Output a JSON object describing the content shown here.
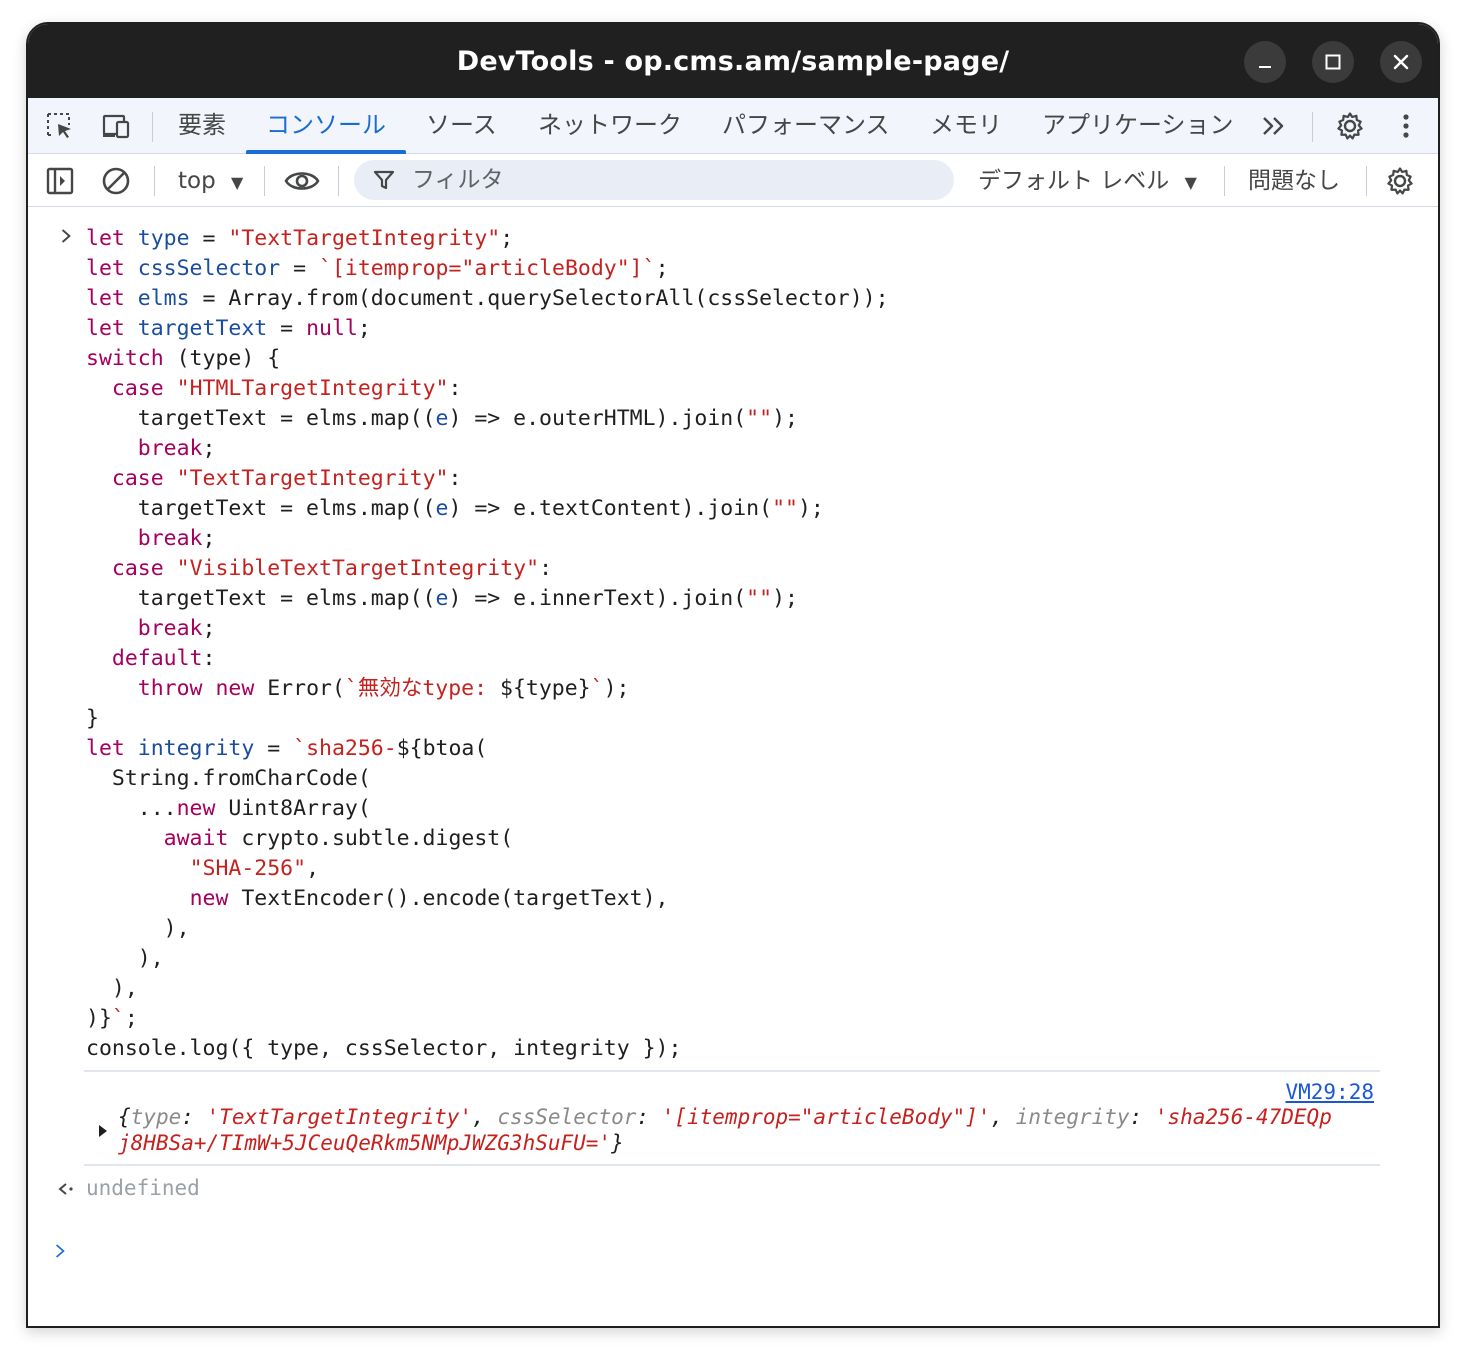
{
  "window": {
    "title": "DevTools - op.cms.am/sample-page/"
  },
  "tabs": [
    {
      "label": "要素"
    },
    {
      "label": "コンソール",
      "active": true
    },
    {
      "label": "ソース"
    },
    {
      "label": "ネットワーク"
    },
    {
      "label": "パフォーマンス"
    },
    {
      "label": "メモリ"
    },
    {
      "label": "アプリケーション"
    }
  ],
  "toolbar": {
    "context": "top",
    "filter_placeholder": "フィルタ",
    "level": "デフォルト レベル",
    "issues": "問題なし"
  },
  "console": {
    "code": [
      [
        {
          "t": "let ",
          "c": "k"
        },
        {
          "t": "type",
          "c": "v"
        },
        {
          "t": " = ",
          "c": "n"
        },
        {
          "t": "\"TextTargetIntegrity\"",
          "c": "s"
        },
        {
          "t": ";",
          "c": "n"
        }
      ],
      [
        {
          "t": "let ",
          "c": "k"
        },
        {
          "t": "cssSelector",
          "c": "v"
        },
        {
          "t": " = ",
          "c": "n"
        },
        {
          "t": "`[itemprop=\"articleBody\"]`",
          "c": "s"
        },
        {
          "t": ";",
          "c": "n"
        }
      ],
      [
        {
          "t": "let ",
          "c": "k"
        },
        {
          "t": "elms",
          "c": "v"
        },
        {
          "t": " = Array.from(document.querySelectorAll(cssSelector));",
          "c": "n"
        }
      ],
      [
        {
          "t": "let ",
          "c": "k"
        },
        {
          "t": "targetText",
          "c": "v"
        },
        {
          "t": " = ",
          "c": "n"
        },
        {
          "t": "null",
          "c": "k"
        },
        {
          "t": ";",
          "c": "n"
        }
      ],
      [
        {
          "t": "switch",
          "c": "k"
        },
        {
          "t": " (type) {",
          "c": "n"
        }
      ],
      [
        {
          "t": "  ",
          "c": "n"
        },
        {
          "t": "case ",
          "c": "k"
        },
        {
          "t": "\"HTMLTargetIntegrity\"",
          "c": "s"
        },
        {
          "t": ":",
          "c": "n"
        }
      ],
      [
        {
          "t": "    targetText = elms.map((",
          "c": "n"
        },
        {
          "t": "e",
          "c": "v"
        },
        {
          "t": ") => e.outerHTML).join(",
          "c": "n"
        },
        {
          "t": "\"\"",
          "c": "s"
        },
        {
          "t": ");",
          "c": "n"
        }
      ],
      [
        {
          "t": "    ",
          "c": "n"
        },
        {
          "t": "break",
          "c": "k"
        },
        {
          "t": ";",
          "c": "n"
        }
      ],
      [
        {
          "t": "  ",
          "c": "n"
        },
        {
          "t": "case ",
          "c": "k"
        },
        {
          "t": "\"TextTargetIntegrity\"",
          "c": "s"
        },
        {
          "t": ":",
          "c": "n"
        }
      ],
      [
        {
          "t": "    targetText = elms.map((",
          "c": "n"
        },
        {
          "t": "e",
          "c": "v"
        },
        {
          "t": ") => e.textContent).join(",
          "c": "n"
        },
        {
          "t": "\"\"",
          "c": "s"
        },
        {
          "t": ");",
          "c": "n"
        }
      ],
      [
        {
          "t": "    ",
          "c": "n"
        },
        {
          "t": "break",
          "c": "k"
        },
        {
          "t": ";",
          "c": "n"
        }
      ],
      [
        {
          "t": "  ",
          "c": "n"
        },
        {
          "t": "case ",
          "c": "k"
        },
        {
          "t": "\"VisibleTextTargetIntegrity\"",
          "c": "s"
        },
        {
          "t": ":",
          "c": "n"
        }
      ],
      [
        {
          "t": "    targetText = elms.map((",
          "c": "n"
        },
        {
          "t": "e",
          "c": "v"
        },
        {
          "t": ") => e.innerText).join(",
          "c": "n"
        },
        {
          "t": "\"\"",
          "c": "s"
        },
        {
          "t": ");",
          "c": "n"
        }
      ],
      [
        {
          "t": "    ",
          "c": "n"
        },
        {
          "t": "break",
          "c": "k"
        },
        {
          "t": ";",
          "c": "n"
        }
      ],
      [
        {
          "t": "  ",
          "c": "n"
        },
        {
          "t": "default",
          "c": "k"
        },
        {
          "t": ":",
          "c": "n"
        }
      ],
      [
        {
          "t": "    ",
          "c": "n"
        },
        {
          "t": "throw ",
          "c": "k"
        },
        {
          "t": "new ",
          "c": "k"
        },
        {
          "t": "Error(",
          "c": "n"
        },
        {
          "t": "`無効なtype: ",
          "c": "s"
        },
        {
          "t": "${type}",
          "c": "n"
        },
        {
          "t": "`",
          "c": "s"
        },
        {
          "t": ");",
          "c": "n"
        }
      ],
      [
        {
          "t": "}",
          "c": "n"
        }
      ],
      [
        {
          "t": "let ",
          "c": "k"
        },
        {
          "t": "integrity",
          "c": "v"
        },
        {
          "t": " = ",
          "c": "n"
        },
        {
          "t": "`sha256-",
          "c": "s"
        },
        {
          "t": "${btoa(",
          "c": "n"
        }
      ],
      [
        {
          "t": "  String.fromCharCode(",
          "c": "n"
        }
      ],
      [
        {
          "t": "    ...",
          "c": "n"
        },
        {
          "t": "new ",
          "c": "k"
        },
        {
          "t": "Uint8Array(",
          "c": "n"
        }
      ],
      [
        {
          "t": "      ",
          "c": "n"
        },
        {
          "t": "await ",
          "c": "k"
        },
        {
          "t": "crypto.subtle.digest(",
          "c": "n"
        }
      ],
      [
        {
          "t": "        ",
          "c": "n"
        },
        {
          "t": "\"SHA-256\"",
          "c": "s"
        },
        {
          "t": ",",
          "c": "n"
        }
      ],
      [
        {
          "t": "        ",
          "c": "n"
        },
        {
          "t": "new ",
          "c": "k"
        },
        {
          "t": "TextEncoder().encode(targetText),",
          "c": "n"
        }
      ],
      [
        {
          "t": "      ),",
          "c": "n"
        }
      ],
      [
        {
          "t": "    ),",
          "c": "n"
        }
      ],
      [
        {
          "t": "  ),",
          "c": "n"
        }
      ],
      [
        {
          "t": ")}",
          "c": "n"
        },
        {
          "t": "`",
          "c": "s"
        },
        {
          "t": ";",
          "c": "n"
        }
      ],
      [
        {
          "t": "console.log({ type, cssSelector, integrity });",
          "c": "n"
        }
      ]
    ],
    "output_source": "VM29:28",
    "output_line1": [
      {
        "t": "{",
        "c": "n"
      },
      {
        "t": "type",
        "c": "okey"
      },
      {
        "t": ": ",
        "c": "n"
      },
      {
        "t": "'TextTargetIntegrity'",
        "c": "ostr"
      },
      {
        "t": ", ",
        "c": "n"
      },
      {
        "t": "cssSelector",
        "c": "okey"
      },
      {
        "t": ": ",
        "c": "n"
      },
      {
        "t": "'[itemprop=\"articleBody\"]'",
        "c": "ostr"
      },
      {
        "t": ", ",
        "c": "n"
      },
      {
        "t": "integrity",
        "c": "okey"
      },
      {
        "t": ": ",
        "c": "n"
      },
      {
        "t": "'sha256-47DEQp",
        "c": "ostr"
      }
    ],
    "output_line2": [
      {
        "t": "j8HBSa+/TImW+5JCeuQeRkm5NMpJWZG3hSuFU='",
        "c": "ostr"
      },
      {
        "t": "}",
        "c": "n"
      }
    ],
    "return_value": "undefined"
  },
  "colors": {
    "accent": "#1a6dd4",
    "keyword": "#a5005e",
    "variable": "#1a4da0",
    "string": "#c5221f",
    "titlebar": "#202020"
  }
}
